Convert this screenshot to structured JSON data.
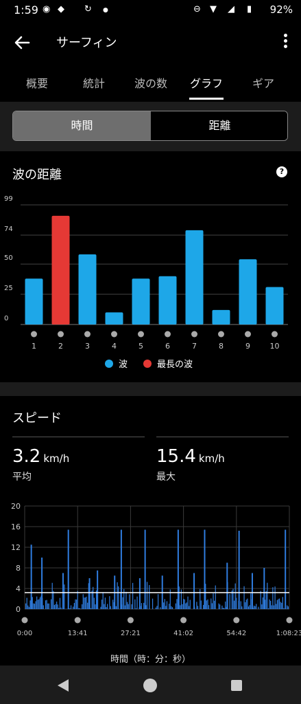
{
  "status_bar": {
    "time": "1:59",
    "battery": "92%"
  },
  "app_bar": {
    "title": "サーフィン"
  },
  "tabs": [
    {
      "label": "概要"
    },
    {
      "label": "統計"
    },
    {
      "label": "波の数"
    },
    {
      "label": "グラフ"
    },
    {
      "label": "ギア"
    }
  ],
  "active_tab": "グラフ",
  "toggle": {
    "selected": "時間",
    "other": "距離"
  },
  "wave_card": {
    "title": "波の距離",
    "legend": [
      {
        "label": "波",
        "color": "#1ea7e8"
      },
      {
        "label": "最長の波",
        "color": "#e53935"
      }
    ]
  },
  "speed_card": {
    "title": "スピード",
    "avg_value": "3.2",
    "avg_unit": "km/h",
    "avg_label": "平均",
    "max_value": "15.4",
    "max_unit": "km/h",
    "max_label": "最大",
    "x_axis_caption": "時間（時：分：秒）"
  },
  "colors": {
    "wave_bar": "#1ea7e8",
    "longest_wave": "#e53935",
    "speed_fill": "#2f7de0",
    "average_line": "#ffffff"
  },
  "chart_data": [
    {
      "type": "bar",
      "title": "波の距離",
      "categories": [
        "1",
        "2",
        "3",
        "4",
        "5",
        "6",
        "7",
        "8",
        "9",
        "10"
      ],
      "values": [
        38,
        90,
        58,
        10,
        38,
        40,
        78,
        12,
        54,
        31
      ],
      "highlight_index": 1,
      "yticks": [
        0,
        25,
        50,
        74,
        99
      ],
      "ylim": [
        0,
        99
      ],
      "grid": true,
      "legend_position": "bottom"
    },
    {
      "type": "area",
      "title": "スピード",
      "xticks": [
        "0:00",
        "13:41",
        "27:21",
        "41:02",
        "54:42",
        "1:08:23"
      ],
      "yticks": [
        0,
        4,
        8,
        12,
        16,
        20
      ],
      "ylim": [
        0,
        20
      ],
      "average": 3.2,
      "max": 15.4,
      "peaks": [
        {
          "t": 0.025,
          "v": 12.5
        },
        {
          "t": 0.065,
          "v": 10
        },
        {
          "t": 0.145,
          "v": 7
        },
        {
          "t": 0.165,
          "v": 15.4
        },
        {
          "t": 0.245,
          "v": 6
        },
        {
          "t": 0.275,
          "v": 7.5
        },
        {
          "t": 0.34,
          "v": 6.5
        },
        {
          "t": 0.365,
          "v": 15.4
        },
        {
          "t": 0.435,
          "v": 6
        },
        {
          "t": 0.455,
          "v": 15.4
        },
        {
          "t": 0.52,
          "v": 6.5
        },
        {
          "t": 0.58,
          "v": 15.4
        },
        {
          "t": 0.64,
          "v": 7
        },
        {
          "t": 0.68,
          "v": 15.4
        },
        {
          "t": 0.765,
          "v": 9
        },
        {
          "t": 0.81,
          "v": 15.2
        },
        {
          "t": 0.86,
          "v": 7
        },
        {
          "t": 0.905,
          "v": 8
        },
        {
          "t": 0.985,
          "v": 15.4
        }
      ]
    }
  ]
}
